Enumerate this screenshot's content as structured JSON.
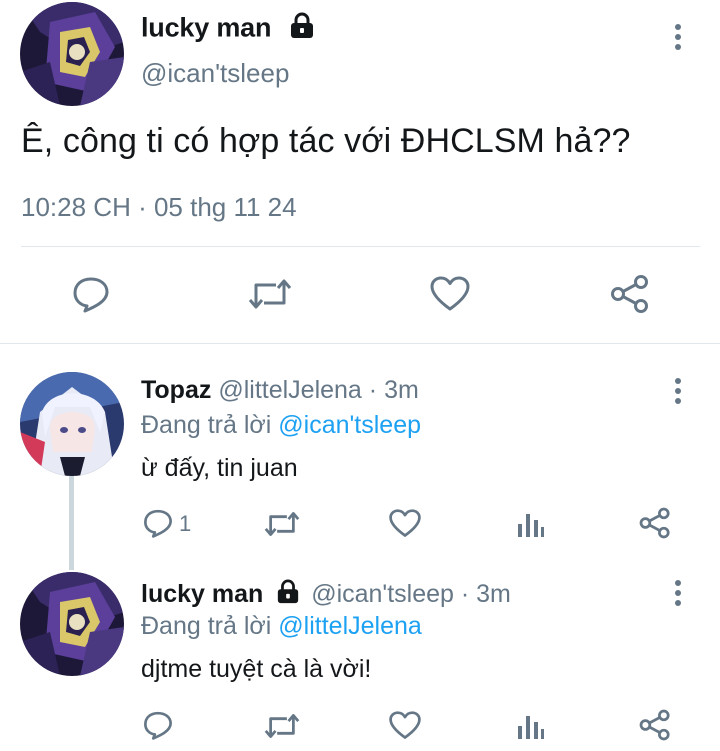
{
  "main_tweet": {
    "display_name": "lucky man",
    "handle": "@ican'tsleep",
    "text": "Ê, công ti có hợp tác với ĐHCLSM hả??",
    "timestamp": "10:28 CH · 05 thg 11 24",
    "avatar_icon": "avatar-lucky-man",
    "verified_icon": "lock-icon"
  },
  "replies": [
    {
      "display_name": "Topaz",
      "handle": "@littelJelena",
      "separator": "·",
      "age": "3m",
      "replying_prefix": "Đang trả lời",
      "replying_to": "@ican'tsleep",
      "text": "ừ đấy, tin juan",
      "reply_count": "1",
      "avatar_icon": "avatar-topaz"
    },
    {
      "display_name": "lucky man",
      "handle": "@ican'tsleep",
      "separator": "·",
      "age": "3m",
      "replying_prefix": "Đang trả lời",
      "replying_to": "@littelJelena",
      "text": "djtme tuyệt cà là vời!",
      "reply_count": "",
      "avatar_icon": "avatar-lucky-man"
    }
  ],
  "colors": {
    "text": "#14171a",
    "secondary": "#657786",
    "link": "#1da1f2",
    "divider": "#e1e8ed"
  }
}
